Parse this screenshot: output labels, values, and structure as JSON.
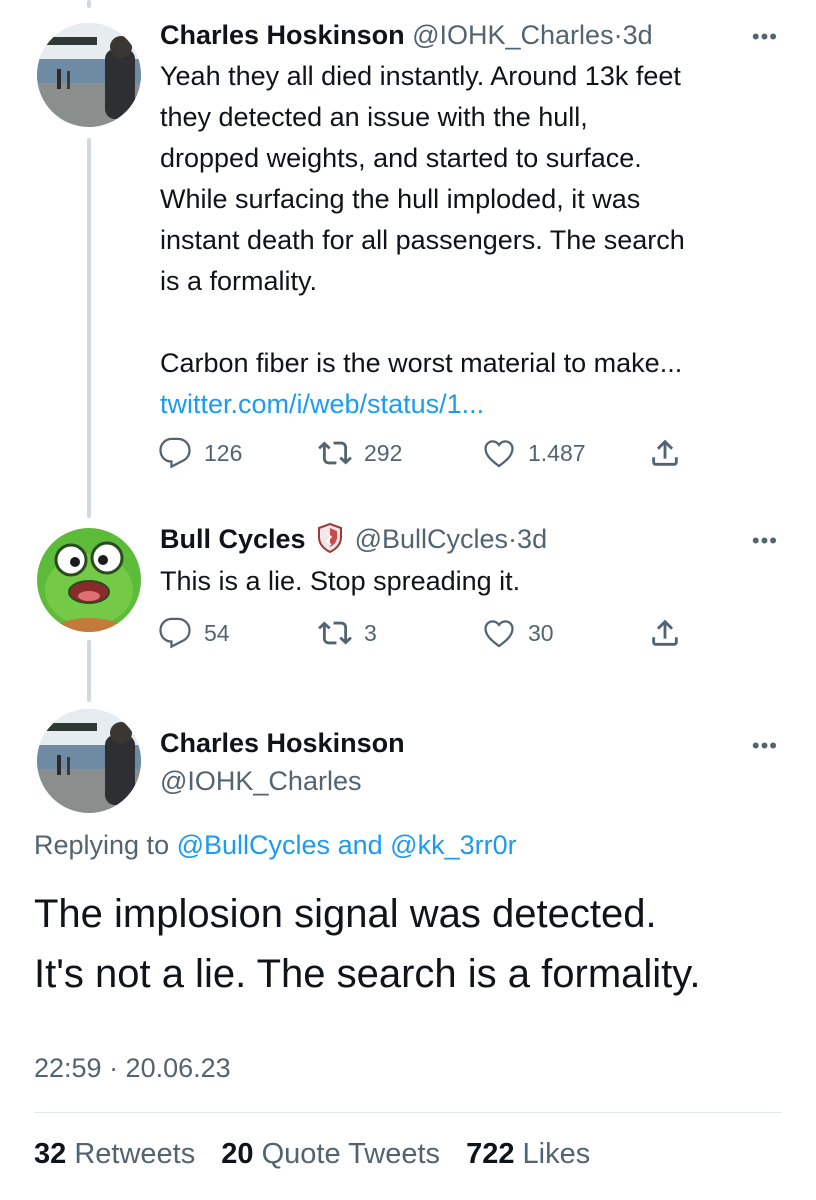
{
  "tweet1": {
    "name": "Charles Hoskinson",
    "handle": "@IOHK_Charles",
    "time": "3d",
    "lines": [
      "Yeah they all died instantly. Around 13k feet",
      "they detected an issue with the hull,",
      "dropped weights, and started to surface.",
      "While surfacing the hull imploded, it was",
      "instant death for all passengers. The search",
      "is a formality."
    ],
    "text2": "Carbon fiber is the worst material to make...",
    "link": "twitter.com/i/web/status/1...",
    "replies": "126",
    "retweets": "292",
    "likes": "1.487"
  },
  "tweet2": {
    "name": "Bull Cycles",
    "handle": "@BullCycles",
    "time": "3d",
    "text": "This is a lie. Stop spreading it.",
    "replies": "54",
    "retweets": "3",
    "likes": "30"
  },
  "main": {
    "name": "Charles Hoskinson",
    "handle": "@IOHK_Charles",
    "replying_prefix": "Replying to",
    "replying_user1": "@BullCycles",
    "replying_and": "and",
    "replying_user2": "@kk_3rr0r",
    "line1": "The implosion signal was detected.",
    "line2": "It's not a lie. The search is a formality.",
    "timestamp": "22:59 · 20.06.23",
    "retweets_count": "32",
    "retweets_label": "Retweets",
    "quotes_count": "20",
    "quotes_label": "Quote Tweets",
    "likes_count": "722",
    "likes_label": "Likes"
  },
  "ui": {
    "more": "•••",
    "dot": "·"
  },
  "icons": [
    "reply-icon",
    "retweet-icon",
    "like-icon",
    "share-icon",
    "verified-shield-icon"
  ],
  "colors": {
    "link": "#1d9bf0",
    "gray": "#536471",
    "text": "#0f1419",
    "thread_line": "#cfd9de"
  }
}
